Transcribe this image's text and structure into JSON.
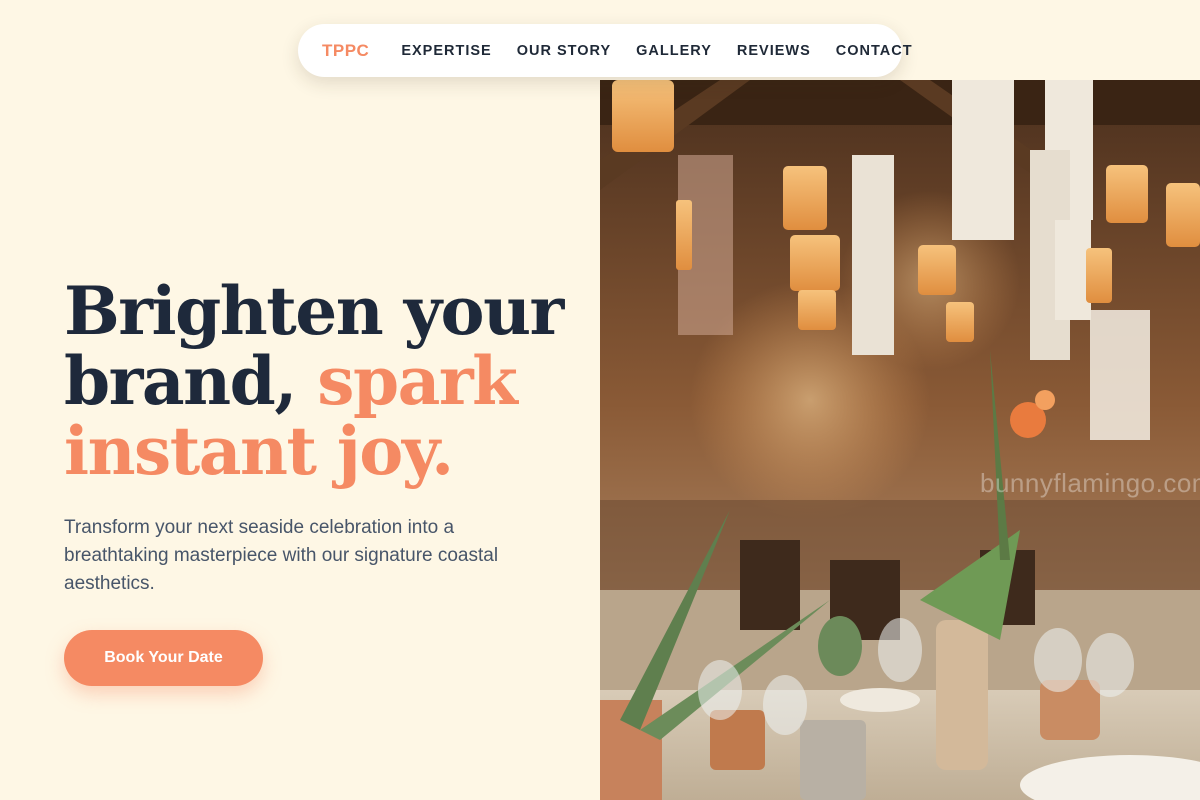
{
  "nav": {
    "logo": "TPPC",
    "links": [
      "EXPERTISE",
      "OUR STORY",
      "GALLERY",
      "REVIEWS",
      "CONTACT"
    ]
  },
  "hero": {
    "headline_part1": "Brighten your brand,",
    "headline_accent1": "spark",
    "headline_accent2": "instant joy.",
    "subtitle": "Transform your next seaside celebration into a breathtaking masterpiece with our signature coastal aesthetics.",
    "cta_label": "Book Your Date"
  },
  "photo": {
    "watermark": "bunnyflamingo.com"
  },
  "colors": {
    "background": "#fef7e5",
    "accent": "#f58a63",
    "heading": "#1e293b",
    "body_text": "#475569"
  }
}
